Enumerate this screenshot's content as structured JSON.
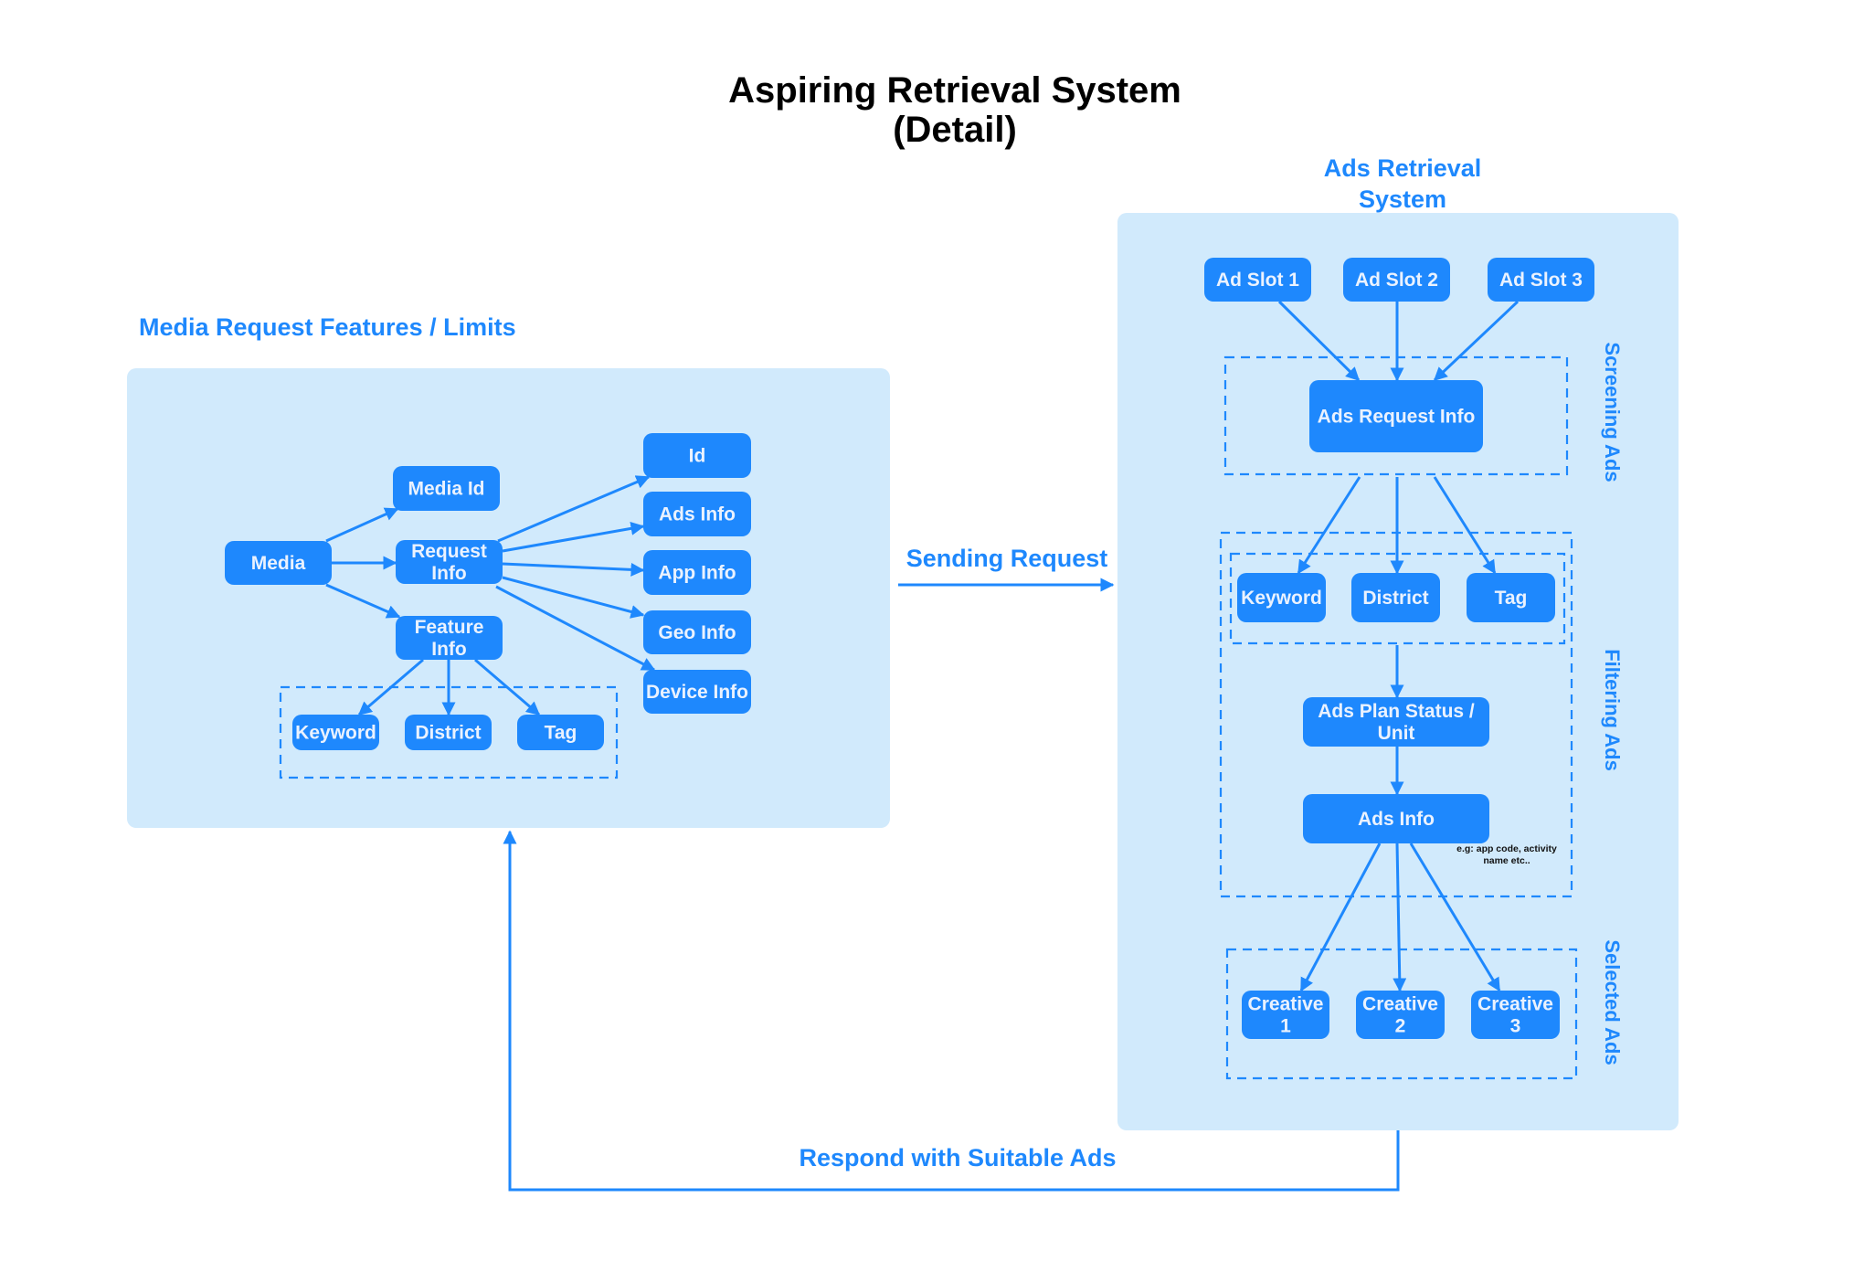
{
  "title": {
    "line1": "Aspiring Retrieval System",
    "line2": "(Detail)"
  },
  "colors": {
    "accent": "#1e88fd",
    "panel": "#d1eafc",
    "node_text": "#eaf2fe",
    "title_text": "#000000"
  },
  "media_panel": {
    "title": "Media Request Features / Limits",
    "nodes": {
      "media": [
        "Media"
      ],
      "media_id": [
        "Media Id"
      ],
      "request_info": [
        "Request",
        "Info"
      ],
      "feature_info": [
        "Feature",
        "Info"
      ],
      "id": [
        "Id"
      ],
      "ads_info": [
        "Ads Info"
      ],
      "app_info": [
        "App Info"
      ],
      "geo_info": [
        "Geo Info"
      ],
      "device_info": [
        "Device Info"
      ],
      "keyword": [
        "Keyword"
      ],
      "district": [
        "District"
      ],
      "tag": [
        "Tag"
      ]
    },
    "edges": [
      [
        "media",
        "media_id"
      ],
      [
        "media",
        "request_info"
      ],
      [
        "media",
        "feature_info"
      ],
      [
        "request_info",
        "id"
      ],
      [
        "request_info",
        "ads_info"
      ],
      [
        "request_info",
        "app_info"
      ],
      [
        "request_info",
        "geo_info"
      ],
      [
        "request_info",
        "device_info"
      ],
      [
        "feature_info",
        "keyword"
      ],
      [
        "feature_info",
        "district"
      ],
      [
        "feature_info",
        "tag"
      ]
    ]
  },
  "flow": {
    "sending_request": "Sending Request",
    "respond": "Respond with Suitable Ads"
  },
  "ads_panel": {
    "title_line1": "Ads Retrieval",
    "title_line2": "System",
    "stages": {
      "screening": "Screening Ads",
      "filtering": "Filtering Ads",
      "selected": "Selected Ads"
    },
    "nodes": {
      "ad_slot_1": [
        "Ad Slot 1"
      ],
      "ad_slot_2": [
        "Ad Slot 2"
      ],
      "ad_slot_3": [
        "Ad Slot 3"
      ],
      "ads_request_info": [
        "Ads  Request Info"
      ],
      "keyword": [
        "Keyword"
      ],
      "district": [
        "District"
      ],
      "tag": [
        "Tag"
      ],
      "ads_plan_status": [
        "Ads Plan Status /",
        "Unit"
      ],
      "ads_info": [
        "Ads Info"
      ],
      "creative_1": [
        "Creative",
        "1"
      ],
      "creative_2": [
        "Creative",
        "2"
      ],
      "creative_3": [
        "Creative",
        "3"
      ]
    },
    "ads_info_note": [
      "e.g: app code, activity",
      "name etc.."
    ],
    "edges": [
      [
        "ad_slot_1",
        "ads_request_info"
      ],
      [
        "ad_slot_2",
        "ads_request_info"
      ],
      [
        "ad_slot_3",
        "ads_request_info"
      ],
      [
        "ads_request_info",
        "keyword"
      ],
      [
        "ads_request_info",
        "district"
      ],
      [
        "ads_request_info",
        "tag"
      ],
      [
        "keyword_group",
        "ads_plan_status"
      ],
      [
        "ads_plan_status",
        "ads_info"
      ],
      [
        "ads_info",
        "creative_1"
      ],
      [
        "ads_info",
        "creative_2"
      ],
      [
        "ads_info",
        "creative_3"
      ]
    ]
  }
}
